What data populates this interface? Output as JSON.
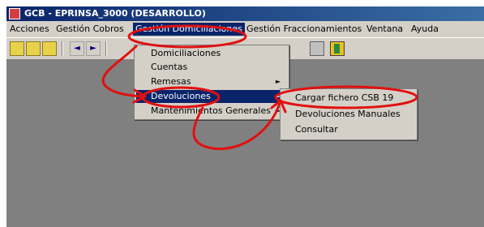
{
  "window": {
    "title": "GCB - EPRINSA_3000 (DESARROLLO)"
  },
  "menubar": {
    "items": [
      "Acciones",
      "Gestión Cobros",
      "Gestión Domiciliaciones",
      "Gestión Fraccionamientos",
      "Ventana",
      "Ayuda"
    ],
    "active": "Gestión Domiciliaciones"
  },
  "toolbar": {
    "icons": [
      "toolbar-icon-1",
      "toolbar-icon-2",
      "toolbar-icon-3",
      "nav-prev-icon",
      "nav-next-icon",
      "save-icon",
      "exit-door-icon"
    ],
    "nav_prev": "◄",
    "nav_next": "►"
  },
  "dropdown": {
    "items": [
      "Domiciliaciones",
      "Cuentas",
      "Remesas",
      "Devoluciones",
      "Mantenimientos Generales"
    ],
    "highlighted": "Devoluciones",
    "submenu_arrow": "►"
  },
  "submenu": {
    "items": [
      "Cargar fichero CSB 19",
      "Devoluciones Manuales",
      "Consultar"
    ]
  },
  "annotation": {
    "color": "#e01010"
  }
}
